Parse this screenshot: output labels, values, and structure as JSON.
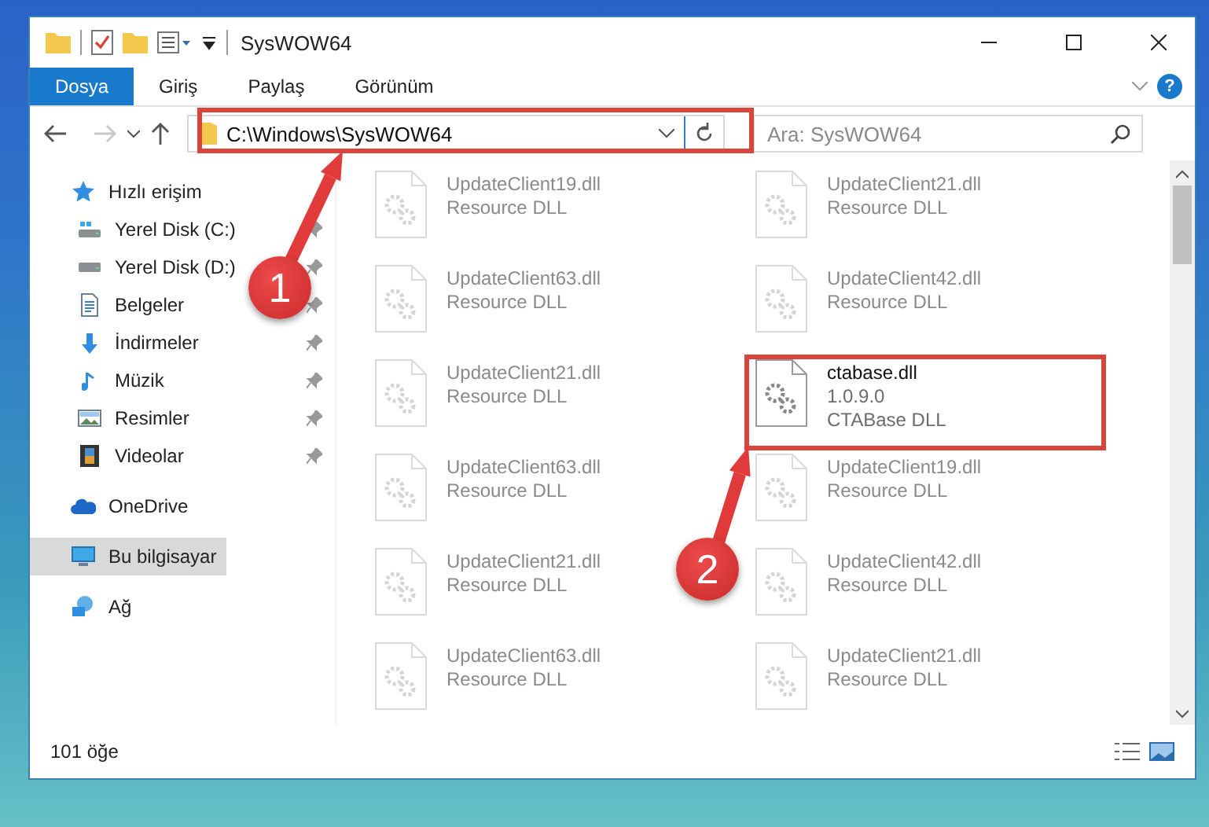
{
  "window": {
    "title": "SysWOW64"
  },
  "ribbon": {
    "tabs": [
      {
        "label": "Dosya",
        "selected": true
      },
      {
        "label": "Giriş",
        "selected": false
      },
      {
        "label": "Paylaş",
        "selected": false
      },
      {
        "label": "Görünüm",
        "selected": false
      }
    ],
    "help_glyph": "?"
  },
  "address_bar": {
    "path": "C:\\Windows\\SysWOW64",
    "forward_disabled": true
  },
  "search": {
    "placeholder": "Ara: SysWOW64"
  },
  "sidebar": {
    "items": [
      {
        "label": "Hızlı erişim",
        "kind": "star",
        "selected": false,
        "children": [
          {
            "label": "Yerel Disk (C:)",
            "kind": "drive-c",
            "pinned": true,
            "selected": false
          },
          {
            "label": "Yerel Disk (D:)",
            "kind": "drive",
            "pinned": true,
            "selected": false
          },
          {
            "label": "Belgeler",
            "kind": "documents",
            "pinned": true,
            "selected": false
          },
          {
            "label": "İndirmeler",
            "kind": "downloads",
            "pinned": true,
            "selected": false
          },
          {
            "label": "Müzik",
            "kind": "music",
            "pinned": true,
            "selected": false
          },
          {
            "label": "Resimler",
            "kind": "pictures",
            "pinned": true,
            "selected": false
          },
          {
            "label": "Videolar",
            "kind": "videos",
            "pinned": true,
            "selected": false
          }
        ]
      },
      {
        "label": "OneDrive",
        "kind": "cloud",
        "selected": false
      },
      {
        "label": "Bu bilgisayar",
        "kind": "computer",
        "selected": true
      },
      {
        "label": "Ağ",
        "kind": "network",
        "selected": false
      }
    ]
  },
  "files": [
    {
      "name": "UpdateClient19.dll",
      "details": [
        "Resource DLL"
      ],
      "kind": "faded"
    },
    {
      "name": "UpdateClient21.dll",
      "details": [
        "Resource DLL"
      ],
      "kind": "faded"
    },
    {
      "name": "UpdateClient63.dll",
      "details": [
        "Resource DLL"
      ],
      "kind": "faded"
    },
    {
      "name": "UpdateClient42.dll",
      "details": [
        "Resource DLL"
      ],
      "kind": "faded"
    },
    {
      "name": "UpdateClient21.dll",
      "details": [
        "Resource DLL"
      ],
      "kind": "faded"
    },
    {
      "name": "ctabase.dll",
      "details": [
        "1.0.9.0",
        "CTABase DLL"
      ],
      "kind": "focus"
    },
    {
      "name": "UpdateClient63.dll",
      "details": [
        "Resource DLL"
      ],
      "kind": "faded"
    },
    {
      "name": "UpdateClient19.dll",
      "details": [
        "Resource DLL"
      ],
      "kind": "faded"
    },
    {
      "name": "UpdateClient21.dll",
      "details": [
        "Resource DLL"
      ],
      "kind": "faded"
    },
    {
      "name": "UpdateClient42.dll",
      "details": [
        "Resource DLL"
      ],
      "kind": "faded"
    },
    {
      "name": "UpdateClient63.dll",
      "details": [
        "Resource DLL"
      ],
      "kind": "faded"
    },
    {
      "name": "UpdateClient21.dll",
      "details": [
        "Resource DLL"
      ],
      "kind": "faded"
    }
  ],
  "status_bar": {
    "count": "101 öğe"
  },
  "annotations": [
    {
      "number": "1"
    },
    {
      "number": "2"
    }
  ]
}
